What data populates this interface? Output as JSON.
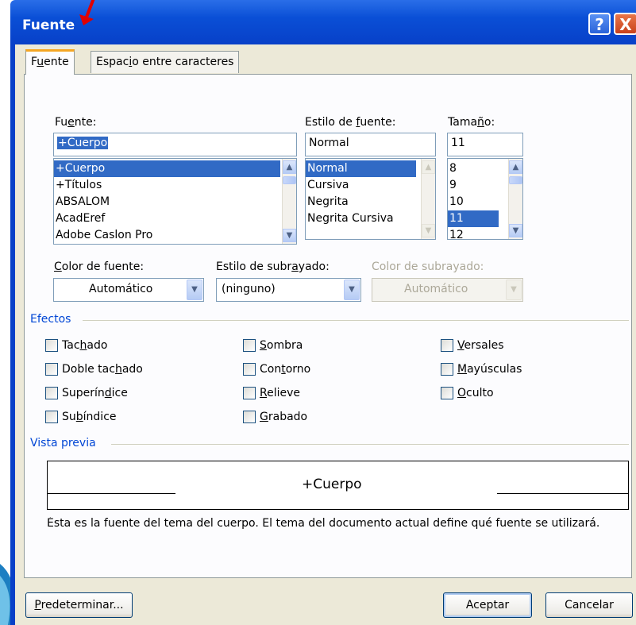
{
  "window": {
    "title": "Fuente",
    "help_glyph": "?",
    "close_glyph": "X"
  },
  "tabs": [
    {
      "label_pre": "F",
      "label_u": "u",
      "label_post": "ente",
      "active": true
    },
    {
      "label_pre": "Espac",
      "label_u": "i",
      "label_post": "o entre caracteres",
      "active": false
    }
  ],
  "font": {
    "label_pre": "Fu",
    "label_u": "e",
    "label_post": "nte:",
    "value": "+Cuerpo",
    "items": [
      "+Cuerpo",
      "+Títulos",
      "ABSALOM",
      "AcadEref",
      "Adobe Caslon Pro"
    ],
    "selected": "+Cuerpo"
  },
  "style": {
    "label_pre": "Estilo de ",
    "label_u": "f",
    "label_post": "uente:",
    "value": "Normal",
    "items": [
      "Normal",
      "Cursiva",
      "Negrita",
      "Negrita Cursiva"
    ],
    "selected": "Normal"
  },
  "size": {
    "label_pre": "Tama",
    "label_u": "ñ",
    "label_post": "o:",
    "value": "11",
    "items": [
      "8",
      "9",
      "10",
      "11",
      "12"
    ],
    "selected": "11"
  },
  "font_color": {
    "label_pre": "",
    "label_u": "C",
    "label_post": "olor de fuente:",
    "value": "Automático"
  },
  "underline_style": {
    "label_pre": "Estilo de subr",
    "label_u": "a",
    "label_post": "yado:",
    "value": "(ninguno)"
  },
  "underline_color": {
    "label": "Color de subrayado:",
    "value": "Automático"
  },
  "effects": {
    "title": "Efectos",
    "col1": [
      {
        "pre": "Tac",
        "u": "h",
        "post": "ado"
      },
      {
        "pre": "Doble tac",
        "u": "h",
        "post": "ado"
      },
      {
        "pre": "Superín",
        "u": "d",
        "post": "ice"
      },
      {
        "pre": "Su",
        "u": "b",
        "post": "índice"
      }
    ],
    "col2": [
      {
        "pre": "",
        "u": "S",
        "post": "ombra"
      },
      {
        "pre": "Con",
        "u": "t",
        "post": "orno"
      },
      {
        "pre": "",
        "u": "R",
        "post": "elieve"
      },
      {
        "pre": "",
        "u": "G",
        "post": "rabado"
      }
    ],
    "col3": [
      {
        "pre": "",
        "u": "V",
        "post": "ersales"
      },
      {
        "pre": "",
        "u": "M",
        "post": "ayúsculas"
      },
      {
        "pre": "",
        "u": "O",
        "post": "culto"
      }
    ]
  },
  "preview": {
    "title": "Vista previa",
    "sample": "+Cuerpo",
    "description": "Ésta es la fuente del tema del cuerpo. El tema del documento actual define qué fuente se utilizará."
  },
  "buttons": {
    "default_pre": "",
    "default_u": "P",
    "default_post": "redeterminar...",
    "ok": "Aceptar",
    "cancel": "Cancelar"
  },
  "colors": {
    "titlebar": "#0840c8",
    "dialog_bg": "#ece9d8",
    "group_title": "#0046d5",
    "selection": "#316ac5",
    "accent_tab": "#f5a623"
  }
}
